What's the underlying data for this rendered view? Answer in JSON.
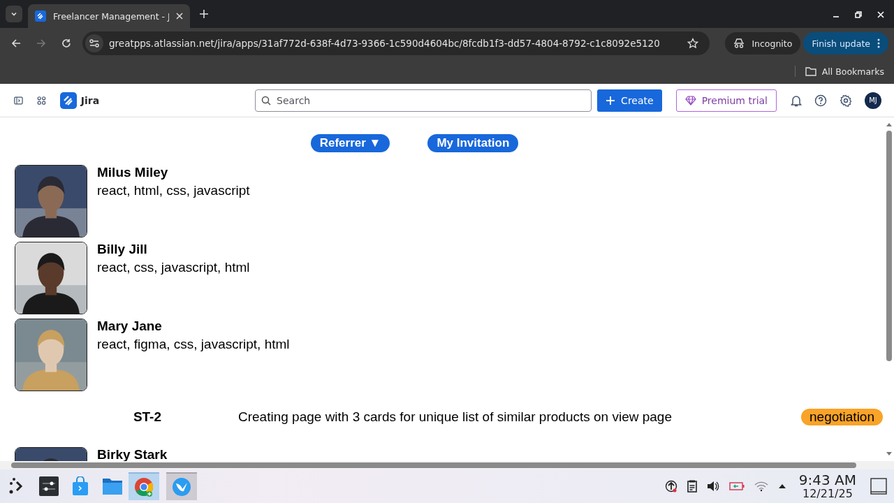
{
  "browser": {
    "tab": {
      "title": "Freelancer Management - J",
      "selected": true
    },
    "url": "greatpps.atlassian.net/jira/apps/31af772d-638f-4d73-9366-1c590d4604bc/8fcdb1f3-dd57-4804-8792-c1c8092e5120",
    "incognito": "Incognito",
    "update": "Finish update",
    "bookmarks": "All Bookmarks"
  },
  "header": {
    "product": "Jira",
    "search": {
      "placeholder": "Search"
    },
    "create": "Create",
    "premium": "Premium trial",
    "avatar": "MJ"
  },
  "filters": [
    {
      "label": "Referrer ▼"
    },
    {
      "label": "My Invitation"
    }
  ],
  "items": [
    {
      "kind": "freelancer",
      "name": "Milus Miley",
      "skills": "react, html, css, javascript"
    },
    {
      "kind": "freelancer",
      "name": "Billy Jill",
      "skills": "react, css, javascript, html"
    },
    {
      "kind": "freelancer",
      "name": "Mary Jane",
      "skills": "react, figma, css, javascript, html"
    },
    {
      "kind": "task",
      "key": "ST-2",
      "summary": "Creating page with 3 cards for unique list of similar products on view page",
      "status": "negotiation",
      "color": "#f9a328"
    },
    {
      "kind": "freelancer",
      "name": "Birky Stark"
    }
  ],
  "taskbar": {
    "time": "9:43 AM",
    "date": "12/21/25"
  }
}
